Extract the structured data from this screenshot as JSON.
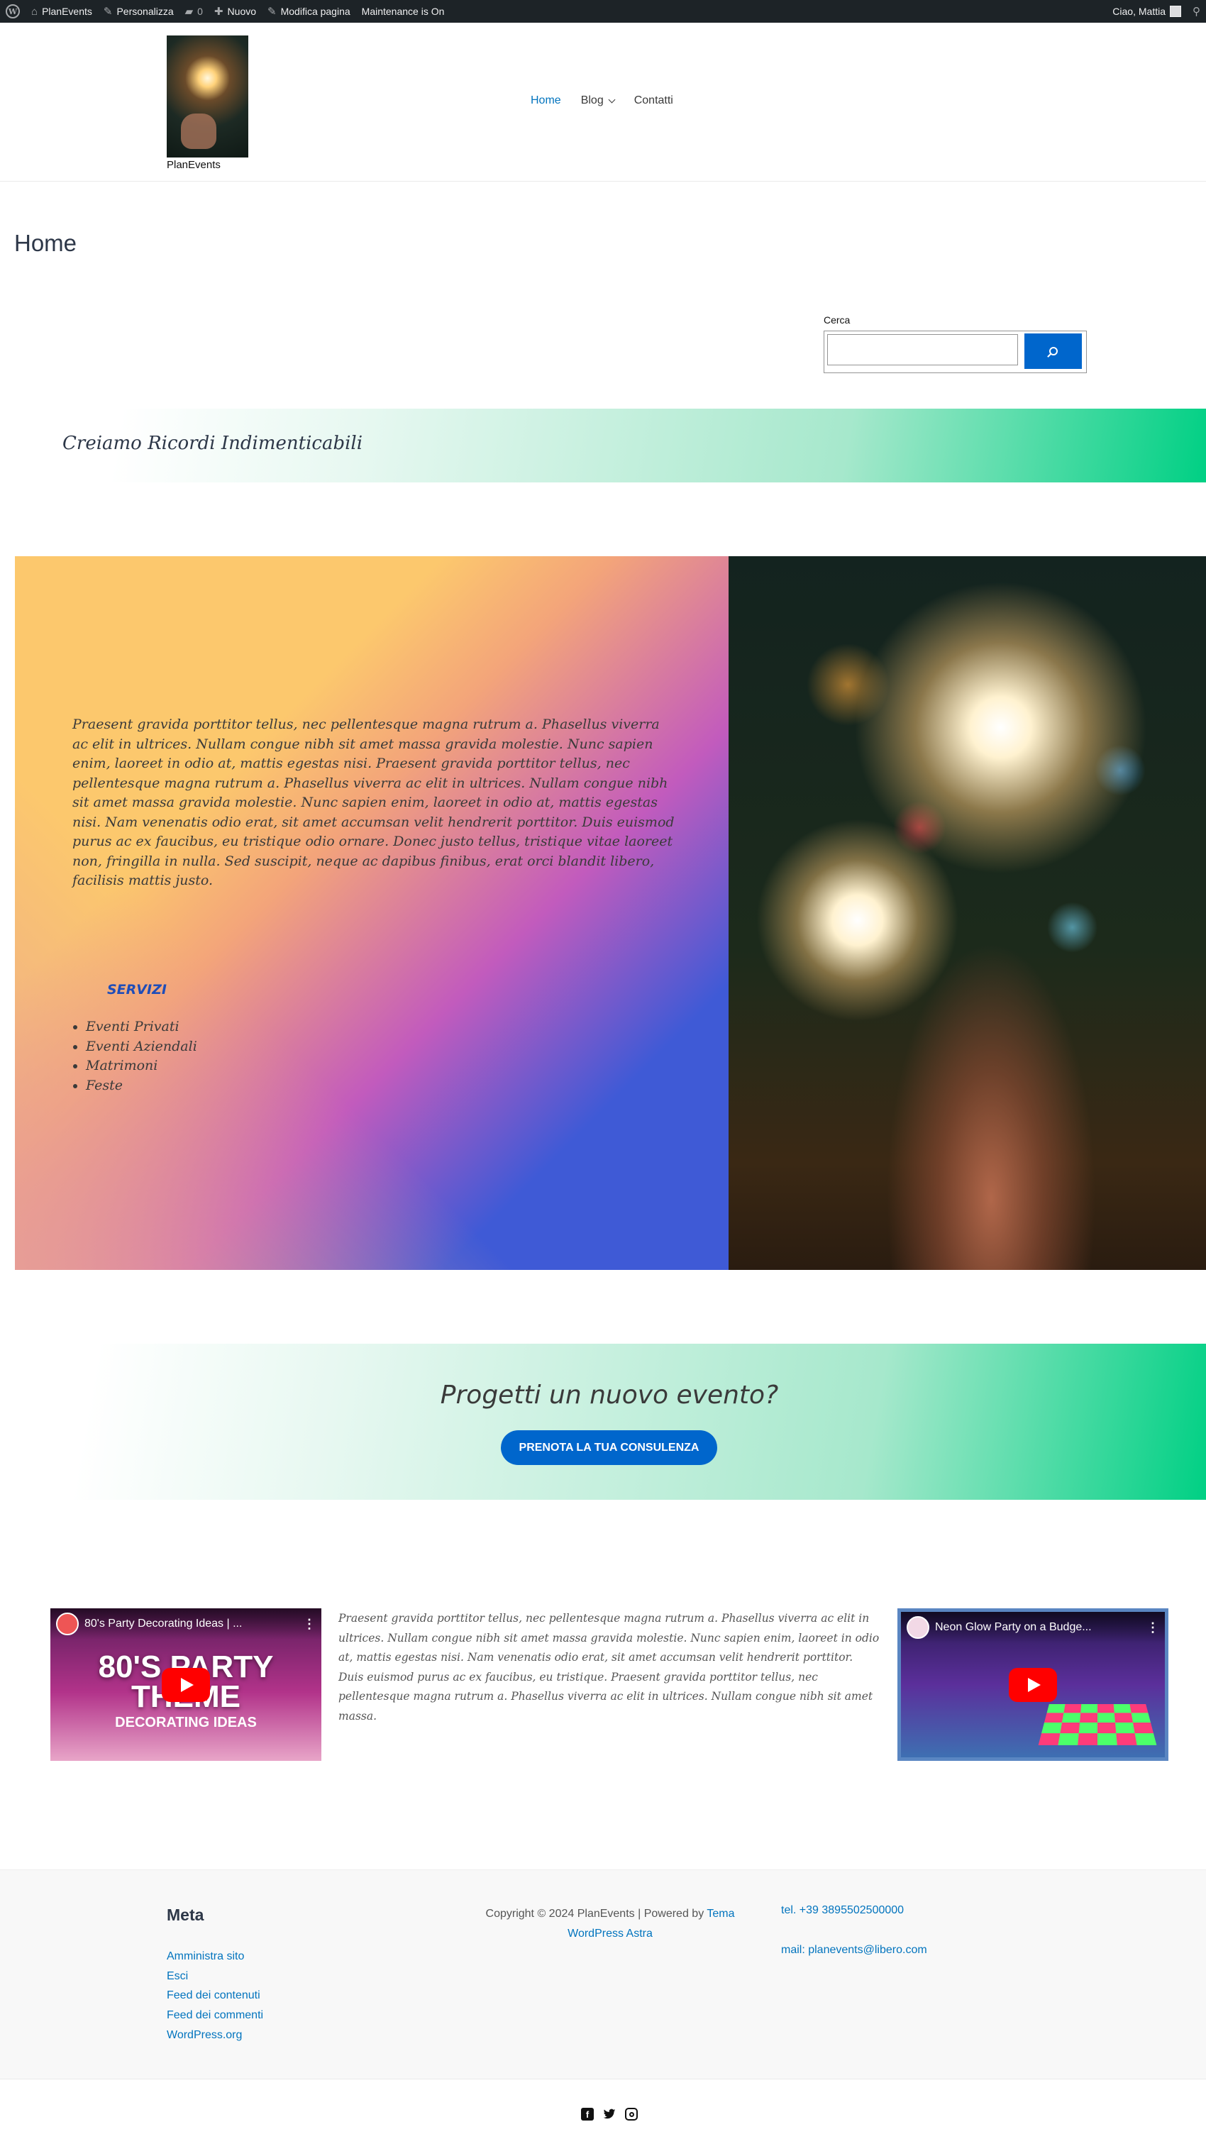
{
  "admin_bar": {
    "site_name": "PlanEvents",
    "customize": "Personalizza",
    "comments_count": "0",
    "new": "Nuovo",
    "edit_page": "Modifica pagina",
    "maintenance": "Maintenance is On",
    "greeting": "Ciao, Mattia"
  },
  "header": {
    "site_title": "PlanEvents",
    "nav": [
      {
        "label": "Home",
        "active": true
      },
      {
        "label": "Blog"
      },
      {
        "label": "Contatti"
      }
    ]
  },
  "page": {
    "title": "Home"
  },
  "search": {
    "label": "Cerca",
    "value": "",
    "button_icon": "search-icon"
  },
  "banner1": {
    "text": "Creiamo Ricordi Indimenticabili"
  },
  "cover": {
    "paragraph": "Praesent gravida porttitor tellus, nec pellentesque magna rutrum a. Phasellus viverra ac elit in ultrices. Nullam congue nibh sit amet massa gravida molestie. Nunc sapien enim, laoreet in odio at, mattis egestas nisi. Praesent gravida porttitor tellus, nec pellentesque magna rutrum a. Phasellus viverra ac elit in ultrices. Nullam congue nibh sit amet massa gravida molestie. Nunc sapien enim, laoreet in odio at, mattis egestas nisi. Nam venenatis odio erat, sit amet accumsan velit hendrerit porttitor. Duis euismod purus ac ex faucibus, eu tristique odio ornare. Donec justo tellus, tristique vitae laoreet non, fringilla in nulla. Sed suscipit, neque ac dapibus finibus, erat orci blandit libero, facilisis mattis justo.",
    "services_heading": "SERVIZI",
    "services": [
      "Eventi Privati",
      "Eventi Aziendali",
      "Matrimoni",
      "Feste"
    ]
  },
  "banner2": {
    "text": "Progetti un nuovo evento?",
    "button": "PRENOTA LA TUA CONSULENZA"
  },
  "videos": [
    {
      "title": "80's Party Decorating Ideas | ...",
      "overlay_line1": "80'S PARTY",
      "overlay_line2": "THEME",
      "overlay_sub": "DECORATING IDEAS"
    },
    {
      "title": "Neon Glow Party on a Budge..."
    }
  ],
  "mid_text": "Praesent gravida porttitor tellus, nec pellentesque magna rutrum a. Phasellus viverra ac elit in ultrices. Nullam congue nibh sit amet massa gravida molestie. Nunc sapien enim, laoreet in odio at, mattis egestas nisi. Nam venenatis odio erat, sit amet accumsan velit hendrerit porttitor. Duis euismod purus ac ex faucibus, eu tristique. Praesent gravida porttitor tellus, nec pellentesque magna rutrum a. Phasellus viverra ac elit in ultrices. Nullam congue nibh sit amet massa.",
  "footer": {
    "meta_title": "Meta",
    "meta_links": [
      "Amministra sito",
      "Esci",
      "Feed dei contenuti",
      "Feed dei commenti",
      "WordPress.org"
    ],
    "copyright_prefix": "Copyright © 2024 PlanEvents | Powered by",
    "copyright_link": "Tema WordPress Astra",
    "tel": "tel. +39 3895502500000",
    "mail": "mail: planevents@libero.com",
    "social": [
      "facebook-icon",
      "twitter-icon",
      "instagram-icon"
    ]
  }
}
